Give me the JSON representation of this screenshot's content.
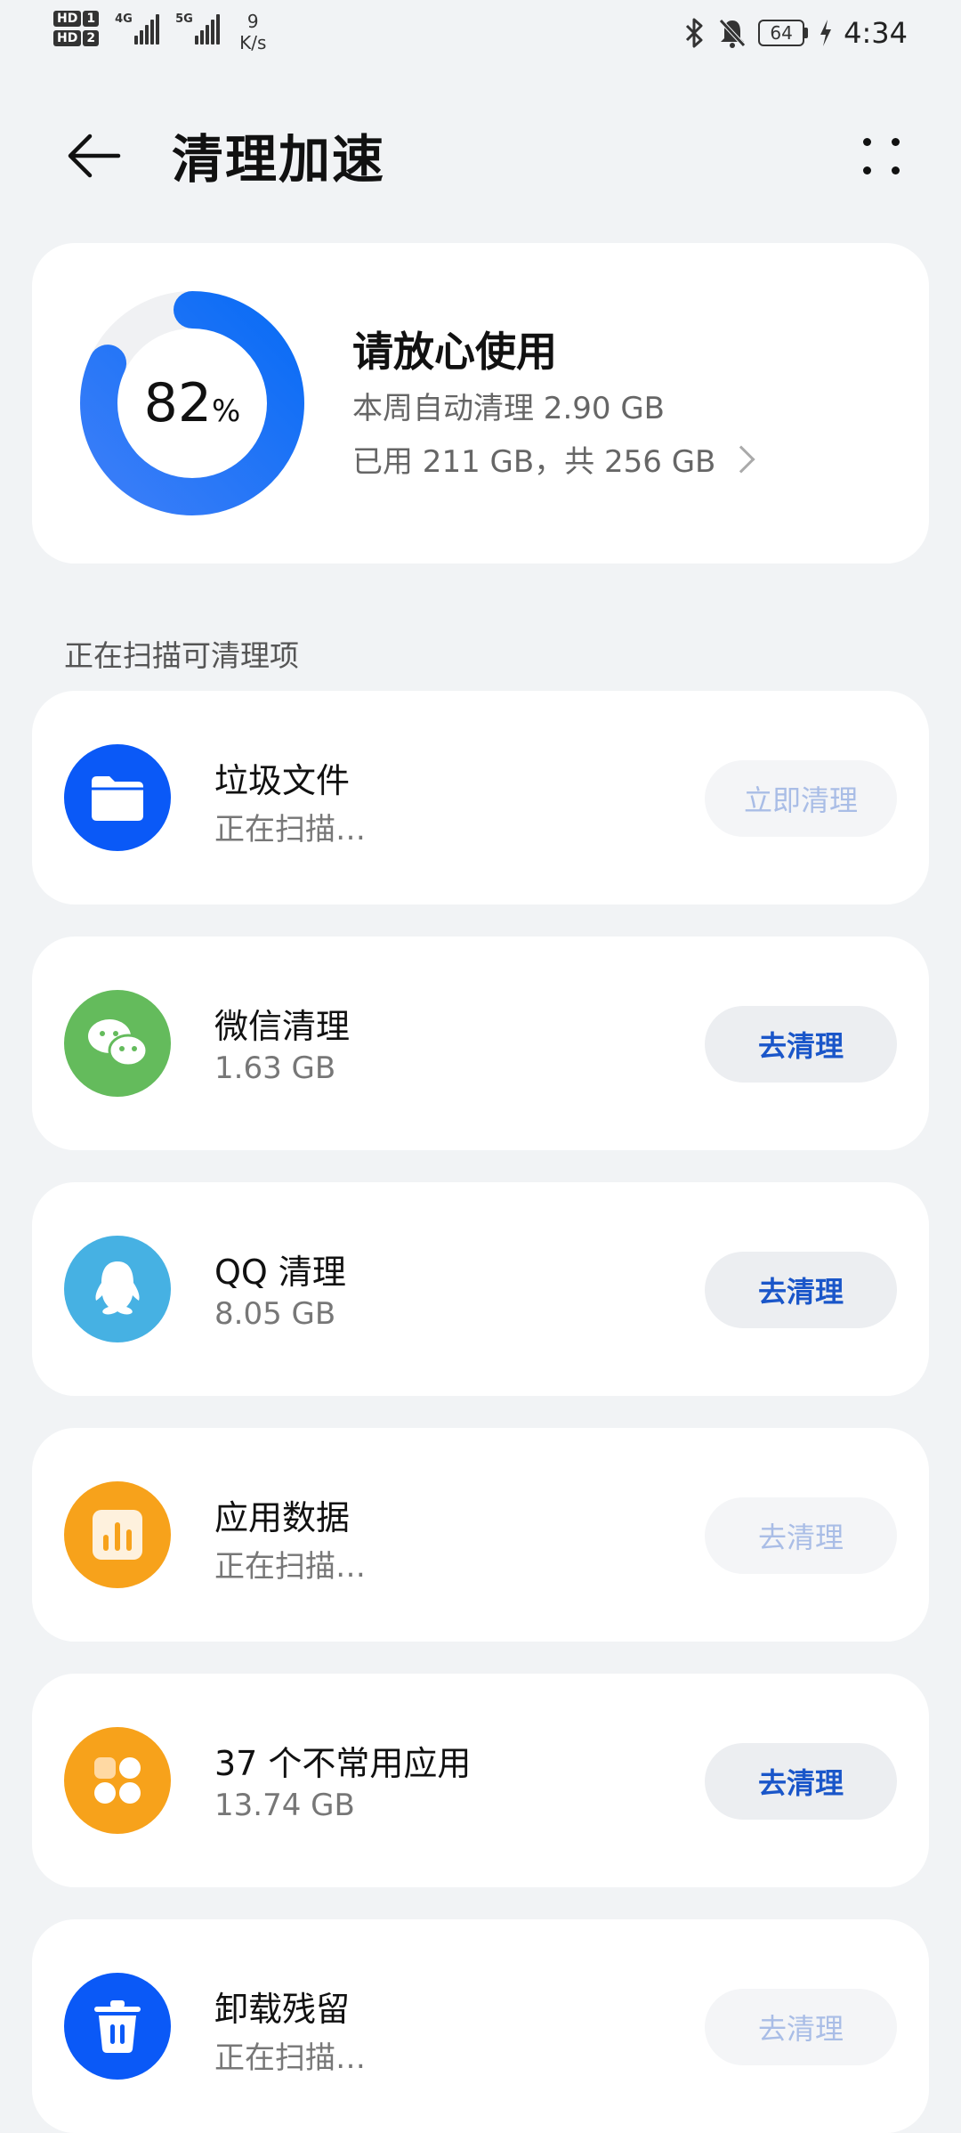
{
  "status_bar": {
    "sim1": "HD",
    "sim1_num": "1",
    "sim2": "HD",
    "sim2_num": "2",
    "net1": "4G",
    "net2": "5G",
    "speed_value": "9",
    "speed_unit": "K/s",
    "battery": "64",
    "time": "4:34"
  },
  "header": {
    "title": "清理加速"
  },
  "storage": {
    "percent": "82",
    "percent_unit": "%",
    "percent_value": 82,
    "title": "请放心使用",
    "weekly_clean": "本周自动清理 2.90 GB",
    "used": "已用 211 GB，共 256 GB"
  },
  "section_label": "正在扫描可清理项",
  "items": [
    {
      "title": "垃圾文件",
      "subtitle": "正在扫描…",
      "button": "立即清理",
      "enabled": false,
      "color": "#0a59f7",
      "icon": "folder-icon"
    },
    {
      "title": "微信清理",
      "subtitle": "1.63 GB",
      "button": "去清理",
      "enabled": true,
      "color": "#64bb5c",
      "icon": "wechat-icon"
    },
    {
      "title": "QQ 清理",
      "subtitle": "8.05 GB",
      "button": "去清理",
      "enabled": true,
      "color": "#46b1e3",
      "icon": "qq-icon"
    },
    {
      "title": "应用数据",
      "subtitle": "正在扫描…",
      "button": "去清理",
      "enabled": false,
      "color": "#f7a21b",
      "icon": "bar-chart-icon"
    },
    {
      "title": "37 个不常用应用",
      "subtitle": "13.74 GB",
      "button": "去清理",
      "enabled": true,
      "color": "#f7a21b",
      "icon": "app-grid-icon"
    },
    {
      "title": "卸载残留",
      "subtitle": "正在扫描…",
      "button": "去清理",
      "enabled": false,
      "color": "#0a59f7",
      "icon": "trash-icon"
    }
  ]
}
